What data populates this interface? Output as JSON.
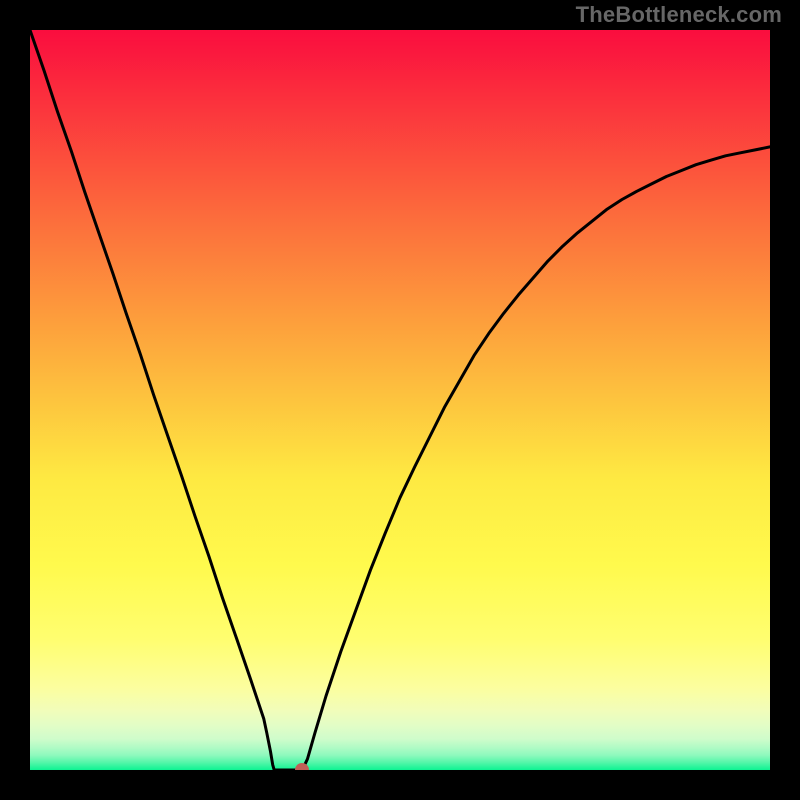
{
  "attribution": "TheBottleneck.com",
  "colors": {
    "marker": "#c15f57",
    "curve": "#000000"
  },
  "chart_data": {
    "type": "line",
    "title": "",
    "xlabel": "",
    "ylabel": "",
    "xlim_frac": [
      0,
      1
    ],
    "ylim_frac": [
      0,
      1
    ],
    "curve_frac": [
      [
        0.0,
        1.0
      ],
      [
        0.019,
        0.945
      ],
      [
        0.037,
        0.89
      ],
      [
        0.056,
        0.836
      ],
      [
        0.074,
        0.781
      ],
      [
        0.093,
        0.726
      ],
      [
        0.112,
        0.671
      ],
      [
        0.13,
        0.617
      ],
      [
        0.149,
        0.562
      ],
      [
        0.167,
        0.507
      ],
      [
        0.186,
        0.452
      ],
      [
        0.205,
        0.397
      ],
      [
        0.223,
        0.343
      ],
      [
        0.242,
        0.288
      ],
      [
        0.26,
        0.233
      ],
      [
        0.279,
        0.178
      ],
      [
        0.298,
        0.123
      ],
      [
        0.316,
        0.069
      ],
      [
        0.32,
        0.05
      ],
      [
        0.325,
        0.025
      ],
      [
        0.328,
        0.007
      ],
      [
        0.33,
        0.0
      ],
      [
        0.34,
        0.0
      ],
      [
        0.35,
        0.0
      ],
      [
        0.36,
        0.0
      ],
      [
        0.368,
        0.0
      ],
      [
        0.375,
        0.015
      ],
      [
        0.385,
        0.05
      ],
      [
        0.4,
        0.1
      ],
      [
        0.42,
        0.16
      ],
      [
        0.44,
        0.215
      ],
      [
        0.46,
        0.27
      ],
      [
        0.48,
        0.32
      ],
      [
        0.5,
        0.368
      ],
      [
        0.52,
        0.41
      ],
      [
        0.54,
        0.45
      ],
      [
        0.56,
        0.49
      ],
      [
        0.58,
        0.525
      ],
      [
        0.6,
        0.56
      ],
      [
        0.62,
        0.59
      ],
      [
        0.64,
        0.617
      ],
      [
        0.66,
        0.642
      ],
      [
        0.68,
        0.665
      ],
      [
        0.7,
        0.688
      ],
      [
        0.72,
        0.708
      ],
      [
        0.74,
        0.726
      ],
      [
        0.76,
        0.742
      ],
      [
        0.78,
        0.758
      ],
      [
        0.8,
        0.771
      ],
      [
        0.82,
        0.782
      ],
      [
        0.84,
        0.792
      ],
      [
        0.86,
        0.802
      ],
      [
        0.88,
        0.81
      ],
      [
        0.9,
        0.818
      ],
      [
        0.92,
        0.824
      ],
      [
        0.94,
        0.83
      ],
      [
        0.96,
        0.834
      ],
      [
        0.98,
        0.838
      ],
      [
        1.0,
        0.842
      ]
    ],
    "marker_frac": {
      "x": 0.368,
      "y": 0.0
    },
    "gradient_stops": [
      {
        "offset": 0.0,
        "color": "#fa0d3e"
      },
      {
        "offset": 0.077,
        "color": "#fb2a3d"
      },
      {
        "offset": 0.258,
        "color": "#fc6e3c"
      },
      {
        "offset": 0.375,
        "color": "#fd983c"
      },
      {
        "offset": 0.5,
        "color": "#fdc43e"
      },
      {
        "offset": 0.605,
        "color": "#fee942"
      },
      {
        "offset": 0.723,
        "color": "#fffa4d"
      },
      {
        "offset": 0.824,
        "color": "#fffe70"
      },
      {
        "offset": 0.888,
        "color": "#fcfe9e"
      },
      {
        "offset": 0.92,
        "color": "#f1fdba"
      },
      {
        "offset": 0.94,
        "color": "#e2fdc6"
      },
      {
        "offset": 0.958,
        "color": "#cffccb"
      },
      {
        "offset": 0.97,
        "color": "#affbc5"
      },
      {
        "offset": 0.98,
        "color": "#8ef9bd"
      },
      {
        "offset": 0.99,
        "color": "#53f6a9"
      },
      {
        "offset": 1.0,
        "color": "#0df392"
      }
    ]
  }
}
